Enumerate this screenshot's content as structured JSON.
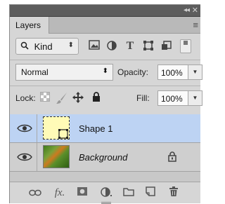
{
  "panel": {
    "title": "Layers",
    "collapse_glyph": "◂◂",
    "close_glyph": "✕",
    "menu_glyph": "≡"
  },
  "filter": {
    "kind_label": "Kind",
    "icons": [
      "image-filter-icon",
      "adjustment-filter-icon",
      "type-filter-icon",
      "shape-filter-icon",
      "smart-object-filter-icon"
    ],
    "type_glyph": "T"
  },
  "blend": {
    "mode": "Normal",
    "opacity_label": "Opacity:",
    "opacity_value": "100%",
    "fill_label": "Fill:",
    "fill_value": "100%"
  },
  "lock": {
    "label": "Lock:"
  },
  "layers": [
    {
      "name": "Shape 1",
      "selected": true,
      "visible": true,
      "locked": false
    },
    {
      "name": "Background",
      "selected": false,
      "visible": true,
      "locked": true
    }
  ],
  "footer": {
    "fx_label": "fx.",
    "icons": [
      "link-layers-icon",
      "fx-icon",
      "add-mask-icon",
      "new-adjustment-icon",
      "new-group-icon",
      "new-layer-icon",
      "delete-layer-icon"
    ]
  },
  "colors": {
    "selected_row": "#bdd3f3",
    "panel_bg": "#d6d6d6",
    "shape_thumb": "#fffbb7"
  }
}
